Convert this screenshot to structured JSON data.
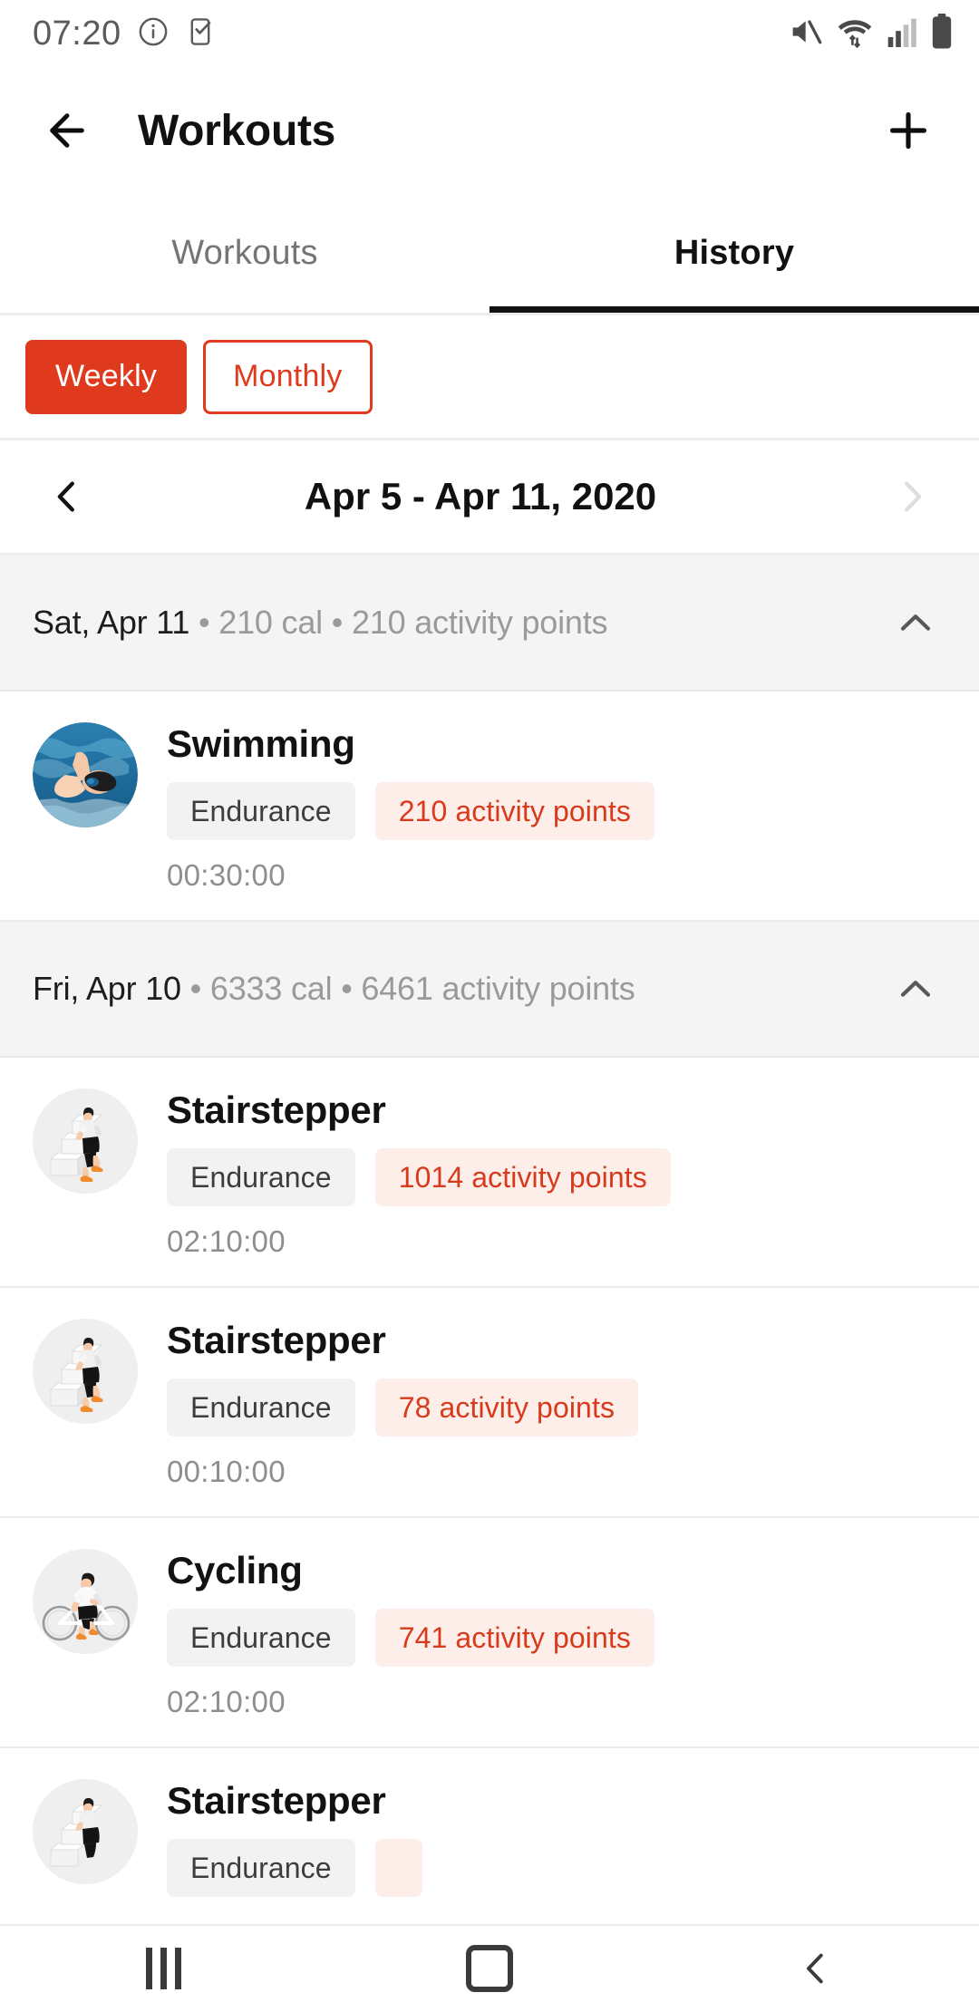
{
  "status_bar": {
    "time": "07:20",
    "left_icons": [
      "info-icon",
      "task-checkbox-icon"
    ],
    "right_icons": [
      "volume-mute-icon",
      "wifi-icon",
      "cellular-signal-icon",
      "battery-icon"
    ]
  },
  "toolbar": {
    "back_icon": "arrow-left-icon",
    "title": "Workouts",
    "add_icon": "plus-icon"
  },
  "tabs": [
    {
      "label": "Workouts",
      "active": false
    },
    {
      "label": "History",
      "active": true
    }
  ],
  "filters": [
    {
      "label": "Weekly",
      "selected": true
    },
    {
      "label": "Monthly",
      "selected": false
    }
  ],
  "date_nav": {
    "prev_icon": "chevron-left-icon",
    "range": "Apr 5 - Apr 11, 2020",
    "next_icon": "chevron-right-icon",
    "prev_enabled": true,
    "next_enabled": false
  },
  "colors": {
    "accent_red": "#DF3A1D",
    "points_text": "#D83A1C",
    "points_bg": "#FDEEEA",
    "category_bg": "#F2F2F2",
    "group_header_bg": "#F4F4F4",
    "muted_text": "#9A9A9A"
  },
  "groups": [
    {
      "date": "Sat, Apr 11",
      "summary": " • 210 cal • 210 activity points",
      "collapse_icon": "chevron-up-icon",
      "expanded": true,
      "workouts": [
        {
          "title": "Swimming",
          "category": "Endurance",
          "points": "210 activity points",
          "duration": "00:30:00",
          "thumb": "swimming-photo"
        }
      ]
    },
    {
      "date": "Fri, Apr 10",
      "summary": " • 6333 cal • 6461 activity points",
      "collapse_icon": "chevron-up-icon",
      "expanded": true,
      "workouts": [
        {
          "title": "Stairstepper",
          "category": "Endurance",
          "points": "1014 activity points",
          "duration": "02:10:00",
          "thumb": "stairstepper-illustration"
        },
        {
          "title": "Stairstepper",
          "category": "Endurance",
          "points": "78 activity points",
          "duration": "00:10:00",
          "thumb": "stairstepper-illustration"
        },
        {
          "title": "Cycling",
          "category": "Endurance",
          "points": "741 activity points",
          "duration": "02:10:00",
          "thumb": "cycling-illustration"
        },
        {
          "title": "Stairstepper",
          "category": "Endurance",
          "points": "",
          "duration": "",
          "thumb": "stairstepper-illustration"
        }
      ]
    }
  ],
  "nav_bar": {
    "recents_icon": "recents-icon",
    "home_icon": "home-icon",
    "back_icon": "chevron-left-icon"
  }
}
